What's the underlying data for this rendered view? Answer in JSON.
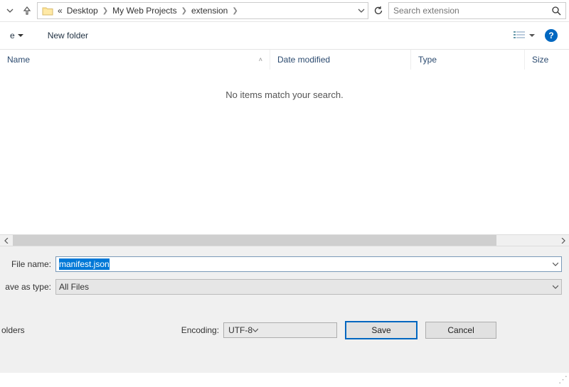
{
  "breadcrumb": {
    "overflow": "«",
    "items": [
      "Desktop",
      "My Web Projects",
      "extension"
    ]
  },
  "search": {
    "placeholder": "Search extension"
  },
  "toolbar": {
    "organize_suffix": "e",
    "new_folder": "New folder"
  },
  "columns": {
    "name": "Name",
    "date": "Date modified",
    "type": "Type",
    "size": "Size"
  },
  "empty_message": "No items match your search.",
  "filename": {
    "label": "File name:",
    "value": "manifest.json"
  },
  "savetype": {
    "label": "ave as type:",
    "value": "All Files"
  },
  "folders_label": "olders",
  "encoding": {
    "label": "Encoding:",
    "value": "UTF-8"
  },
  "buttons": {
    "save": "Save",
    "cancel": "Cancel"
  }
}
